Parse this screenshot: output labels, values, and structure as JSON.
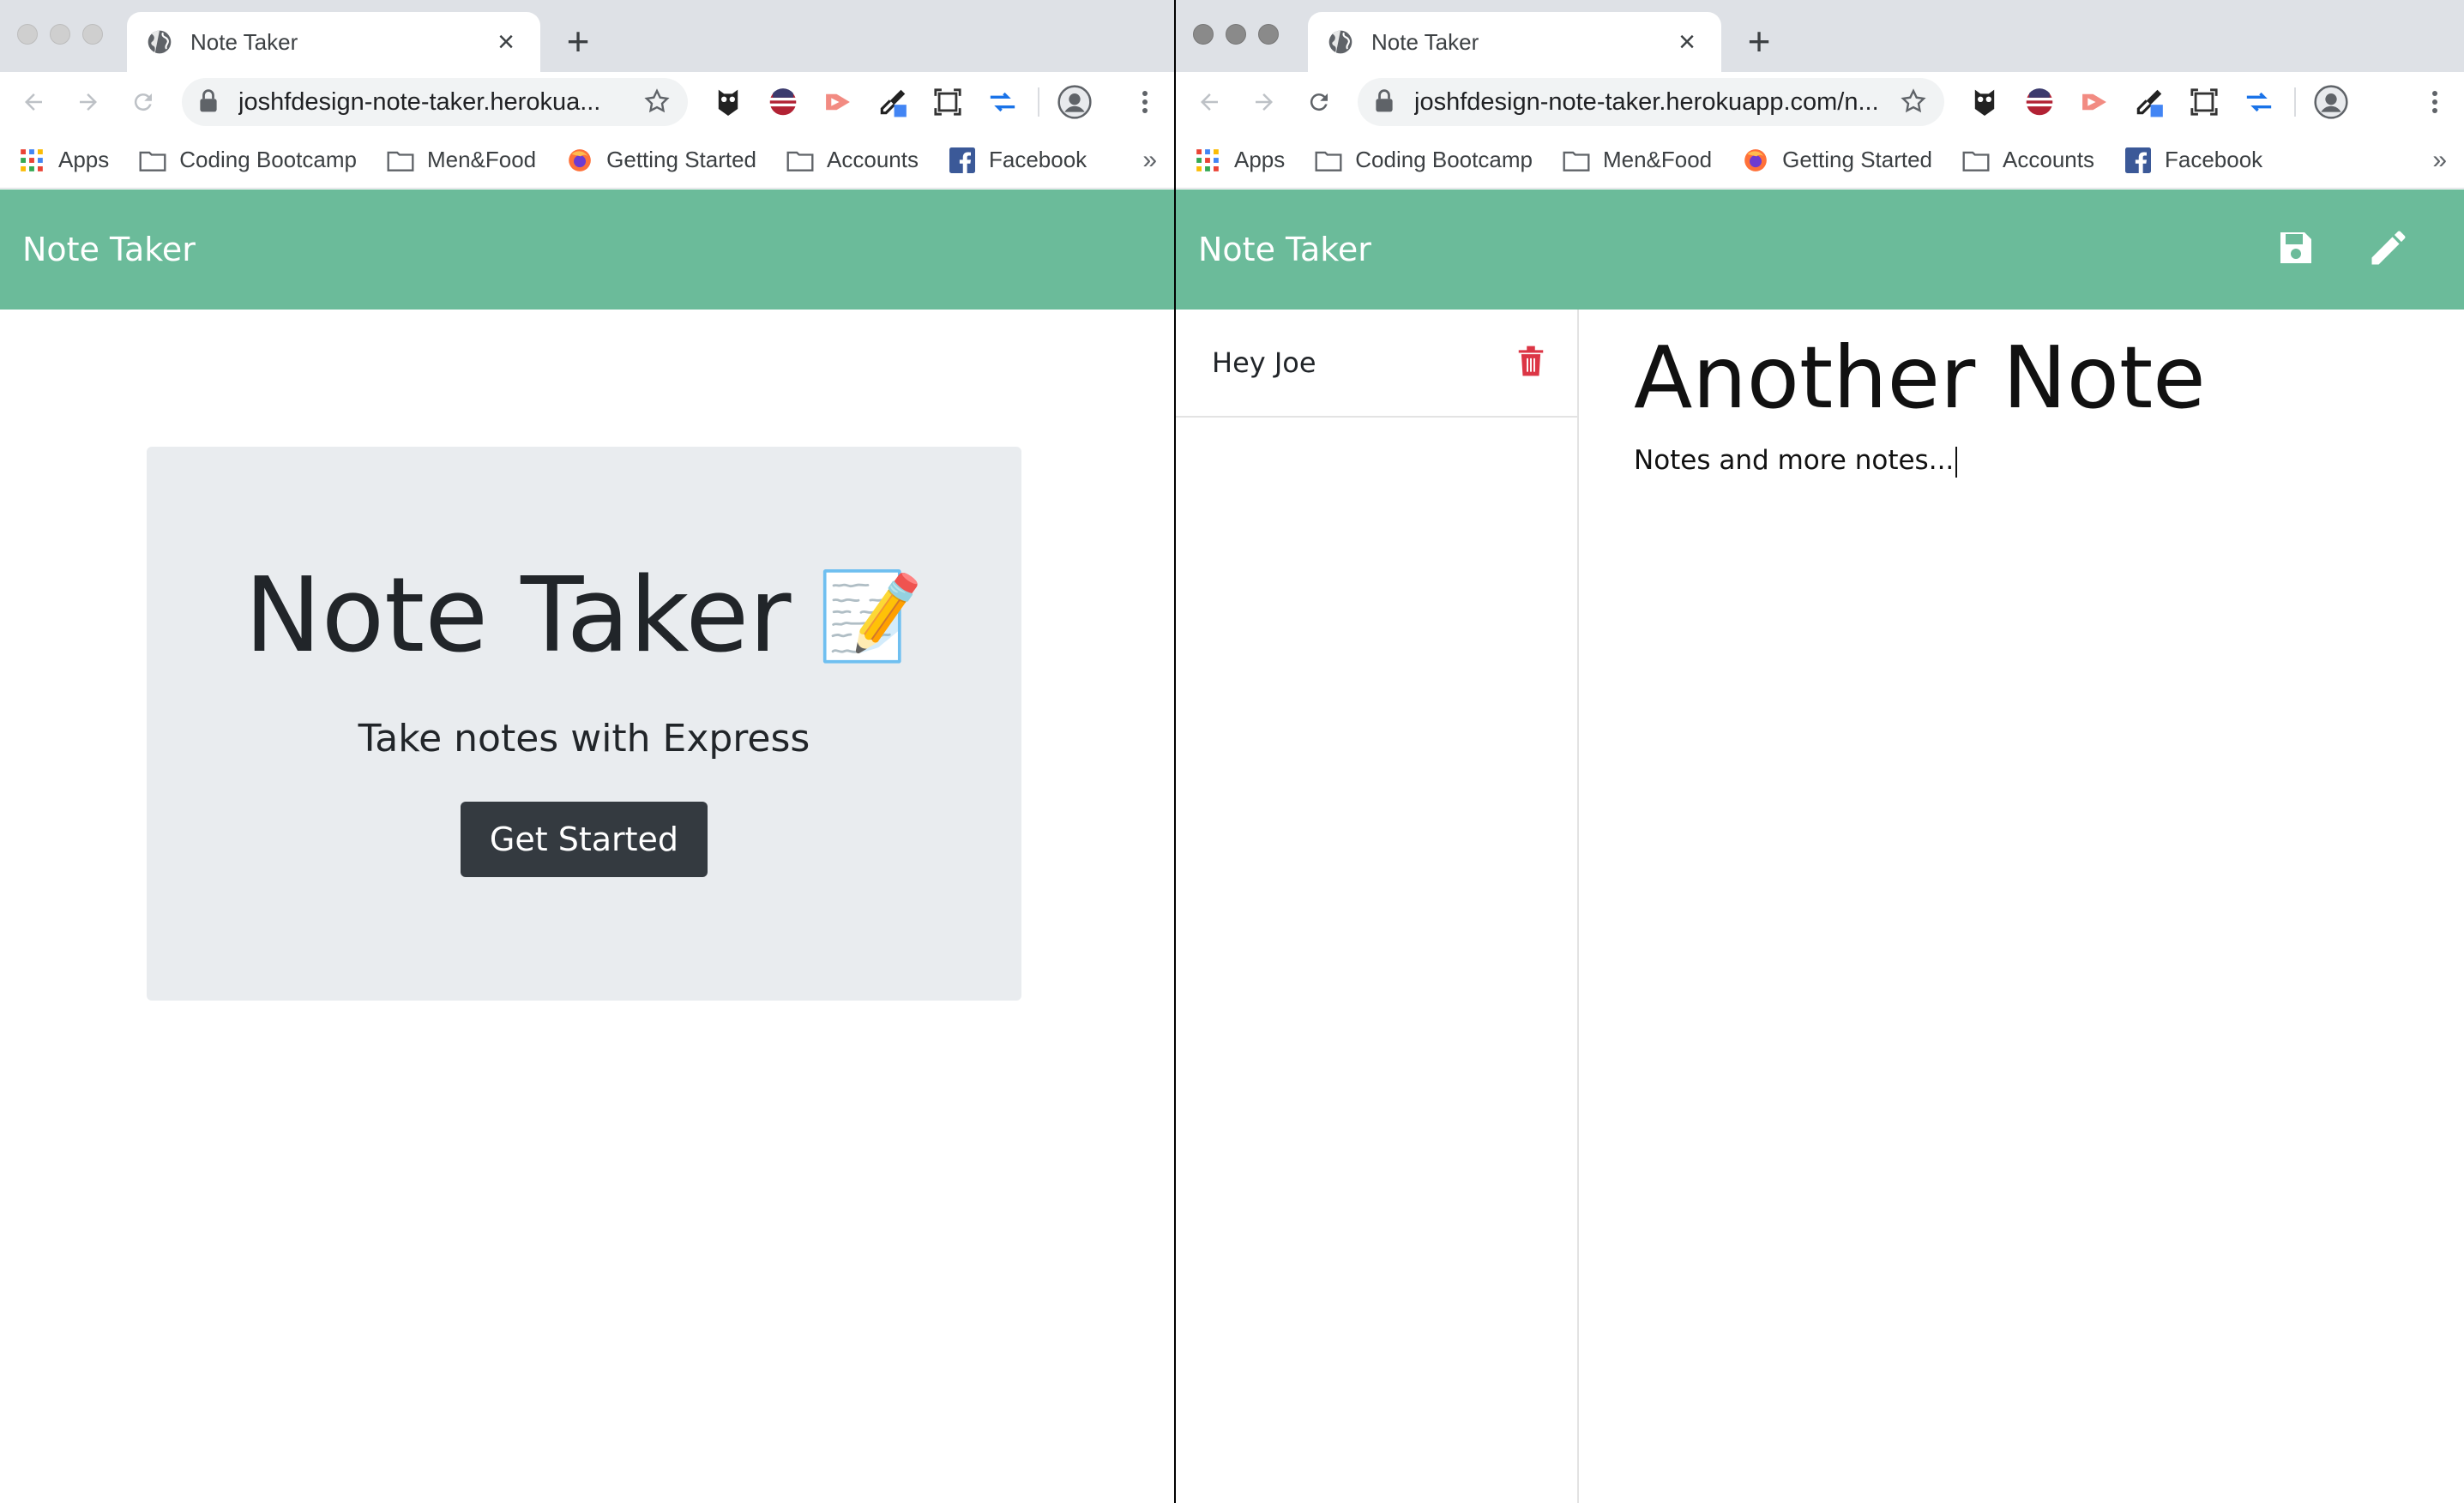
{
  "windows": [
    {
      "tab_title": "Note Taker",
      "url": "joshfdesign-note-taker.herokua...",
      "bookmarks": [
        "Apps",
        "Coding Bootcamp",
        "Men&Food",
        "Getting Started",
        "Accounts",
        "Facebook"
      ],
      "more": "»"
    },
    {
      "tab_title": "Note Taker",
      "url": "joshfdesign-note-taker.herokuapp.com/n...",
      "bookmarks": [
        "Apps",
        "Coding Bootcamp",
        "Men&Food",
        "Getting Started",
        "Accounts",
        "Facebook"
      ],
      "more": "»"
    }
  ],
  "app": {
    "brand": "Note Taker",
    "accent": "#6bbb9a"
  },
  "landing": {
    "heading": "Note Taker",
    "emoji": "📝",
    "subtitle": "Take notes with Express",
    "cta": "Get Started"
  },
  "notes_page": {
    "list": [
      {
        "title": "Hey Joe"
      }
    ],
    "active_title": "Another Note",
    "active_text": "Notes and more notes..."
  },
  "icons": {
    "tab": "globe-icon",
    "save": "save-icon",
    "new": "pencil-icon",
    "delete": "trash-icon"
  },
  "colors": {
    "delete": "#dc3545",
    "button_dark": "#343a40"
  }
}
